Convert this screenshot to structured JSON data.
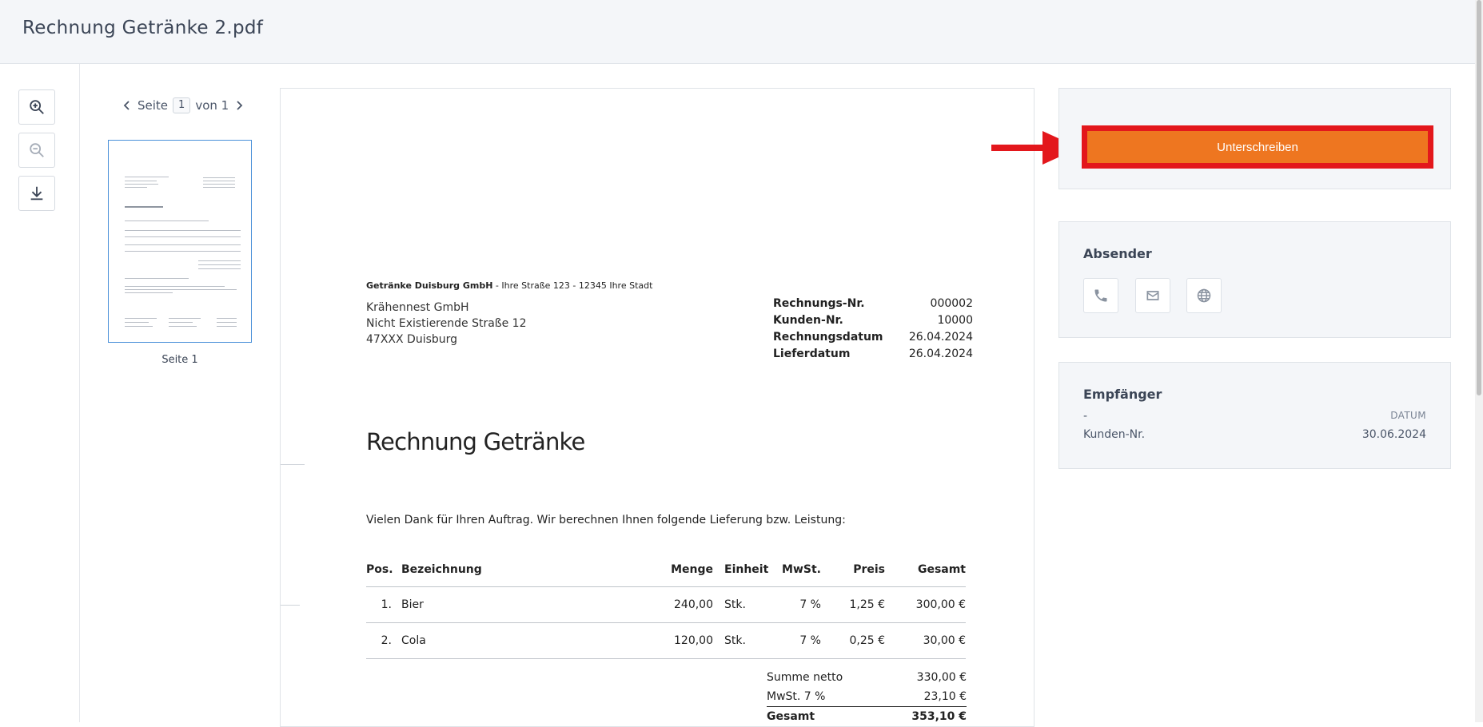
{
  "header": {
    "title": "Rechnung Getränke 2.pdf"
  },
  "viewer": {
    "page_label": "Seite",
    "page_current": "1",
    "page_of": "von 1",
    "thumb_label": "Seite 1"
  },
  "invoice": {
    "sender_company": "Getränke Duisburg GmbH",
    "sender_address": " - Ihre Straße 123 - 12345 Ihre Stadt",
    "recipient": [
      "Krähennest GmbH",
      "Nicht Existierende Straße 12",
      "47XXX Duisburg"
    ],
    "meta": [
      {
        "key": "Rechnungs-Nr.",
        "value": "000002"
      },
      {
        "key": "Kunden-Nr.",
        "value": "10000"
      },
      {
        "key": "Rechnungsdatum",
        "value": "26.04.2024"
      },
      {
        "key": "Lieferdatum",
        "value": "26.04.2024"
      }
    ],
    "title": "Rechnung Getränke",
    "intro": "Vielen Dank für Ihren Auftrag. Wir berechnen Ihnen folgende Lieferung bzw. Leistung:",
    "columns": [
      "Pos.",
      "Bezeichnung",
      "Menge",
      "Einheit",
      "MwSt.",
      "Preis",
      "Gesamt"
    ],
    "rows": [
      [
        "1.",
        "Bier",
        "240,00",
        "Stk.",
        "7 %",
        "1,25 €",
        "300,00 €"
      ],
      [
        "2.",
        "Cola",
        "120,00",
        "Stk.",
        "7 %",
        "0,25 €",
        "30,00 €"
      ]
    ],
    "totals": [
      {
        "label": "Summe netto",
        "value": "330,00 €"
      },
      {
        "label": "MwSt. 7 %",
        "value": "23,10 €"
      },
      {
        "label": "Gesamt",
        "value": "353,10 €"
      }
    ]
  },
  "sidebar": {
    "sign_label": "Unterschreiben",
    "sender_title": "Absender",
    "recipient_title": "Empfänger",
    "recipient_name": "-",
    "date_label": "DATUM",
    "customer_label": "Kunden-Nr.",
    "date_value": "30.06.2024"
  },
  "colors": {
    "accent": "#ee7620",
    "highlight": "#e3171c"
  },
  "icons": [
    "zoom-in-icon",
    "zoom-out-icon",
    "download-icon",
    "phone-icon",
    "mail-icon",
    "globe-icon",
    "chevron-left-icon",
    "chevron-right-icon",
    "arrow-right-icon"
  ]
}
